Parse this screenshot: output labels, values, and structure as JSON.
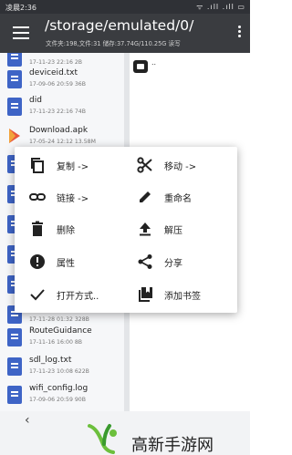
{
  "status_bar": {
    "time": "凌晨2:36",
    "icons": "ᯤ .ıll .ıll ▭"
  },
  "toolbar": {
    "path": "/storage/emulated/0/",
    "info": "文件夹:198,文件:31  储存:37.74G/110.25G  读写"
  },
  "right_pane": {
    "parent_label": ".."
  },
  "files": [
    {
      "name": "",
      "meta": "17-11-23 22:16  2B",
      "type": "doc"
    },
    {
      "name": "deviceid.txt",
      "meta": "17-09-06 20:59  36B",
      "type": "doc"
    },
    {
      "name": "did",
      "meta": "17-11-23 22:16  74B",
      "type": "doc"
    },
    {
      "name": "Download.apk",
      "meta": "17-05-24 12:12  13.58M",
      "type": "apk"
    },
    {
      "name": "",
      "meta": "",
      "type": "doc"
    },
    {
      "name": "",
      "meta": "",
      "type": "doc"
    },
    {
      "name": "",
      "meta": "",
      "type": "doc"
    },
    {
      "name": "",
      "meta": "",
      "type": "doc"
    },
    {
      "name": "",
      "meta": "",
      "type": "doc"
    },
    {
      "name": "",
      "meta": "17-11-28 01:32  328B",
      "type": "doc"
    },
    {
      "name": "RouteGuidance",
      "meta": "17-11-16 16:00  8B",
      "type": "doc"
    },
    {
      "name": "sdl_log.txt",
      "meta": "17-11-23 10:08  622B",
      "type": "doc"
    },
    {
      "name": "wifi_config.log",
      "meta": "17-09-06 20:59  90B",
      "type": "doc"
    }
  ],
  "context_menu": {
    "items": [
      {
        "label": "复制 ->",
        "icon": "copy-icon"
      },
      {
        "label": "移动 ->",
        "icon": "cut-icon"
      },
      {
        "label": "链接 ->",
        "icon": "link-icon"
      },
      {
        "label": "重命名",
        "icon": "edit-icon"
      },
      {
        "label": "删除",
        "icon": "trash-icon"
      },
      {
        "label": "解压",
        "icon": "extract-icon"
      },
      {
        "label": "属性",
        "icon": "info-icon"
      },
      {
        "label": "分享",
        "icon": "share-icon"
      },
      {
        "label": "打开方式..",
        "icon": "check-icon"
      },
      {
        "label": "添加书签",
        "icon": "bookmark-icon"
      }
    ]
  },
  "bottom_bar": {
    "back": "‹"
  },
  "watermark": {
    "text": "高新手游网"
  },
  "colors": {
    "toolbar": "#3a3c40",
    "statusbar": "#2f3136",
    "file_icon": "#3e64c6",
    "apk_icon": "#e8553e"
  }
}
